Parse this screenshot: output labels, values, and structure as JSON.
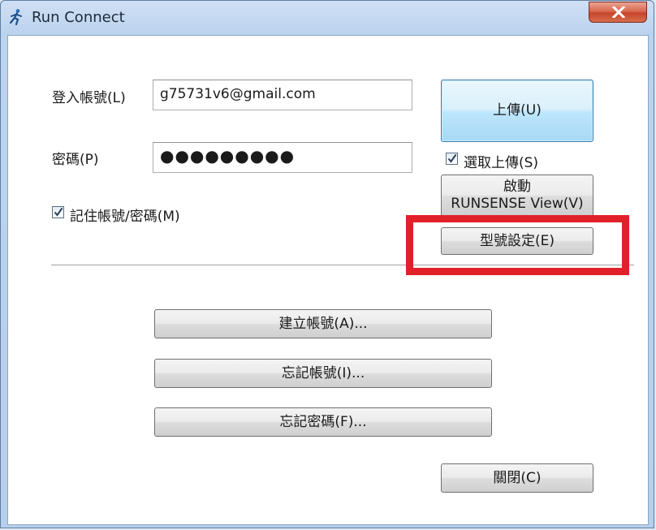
{
  "window": {
    "title": "Run Connect"
  },
  "form": {
    "account_label": "登入帳號(L)",
    "account_value": "g75731v6@gmail.com",
    "password_label": "密碼(P)",
    "password_value": "●●●●●●●●●",
    "remember_label": "記住帳號/密碼(M)",
    "remember_checked": true
  },
  "actions": {
    "upload_label": "上傳(U)",
    "select_upload_label": "選取上傳(S)",
    "select_upload_checked": true,
    "launch_line1": "啟動",
    "launch_line2": "RUNSENSE View(V)",
    "model_settings_label": "型號設定(E)",
    "create_account_label": "建立帳號(A)...",
    "forgot_account_label": "忘記帳號(I)...",
    "forgot_password_label": "忘記密碼(F)...",
    "close_label": "關閉(C)"
  },
  "colors": {
    "highlight": "#e2202a",
    "primary_button": "#bee6fd",
    "close_button": "#c7452a"
  },
  "icons": {
    "app": "runner-icon",
    "close": "close-icon",
    "check": "check-icon"
  }
}
